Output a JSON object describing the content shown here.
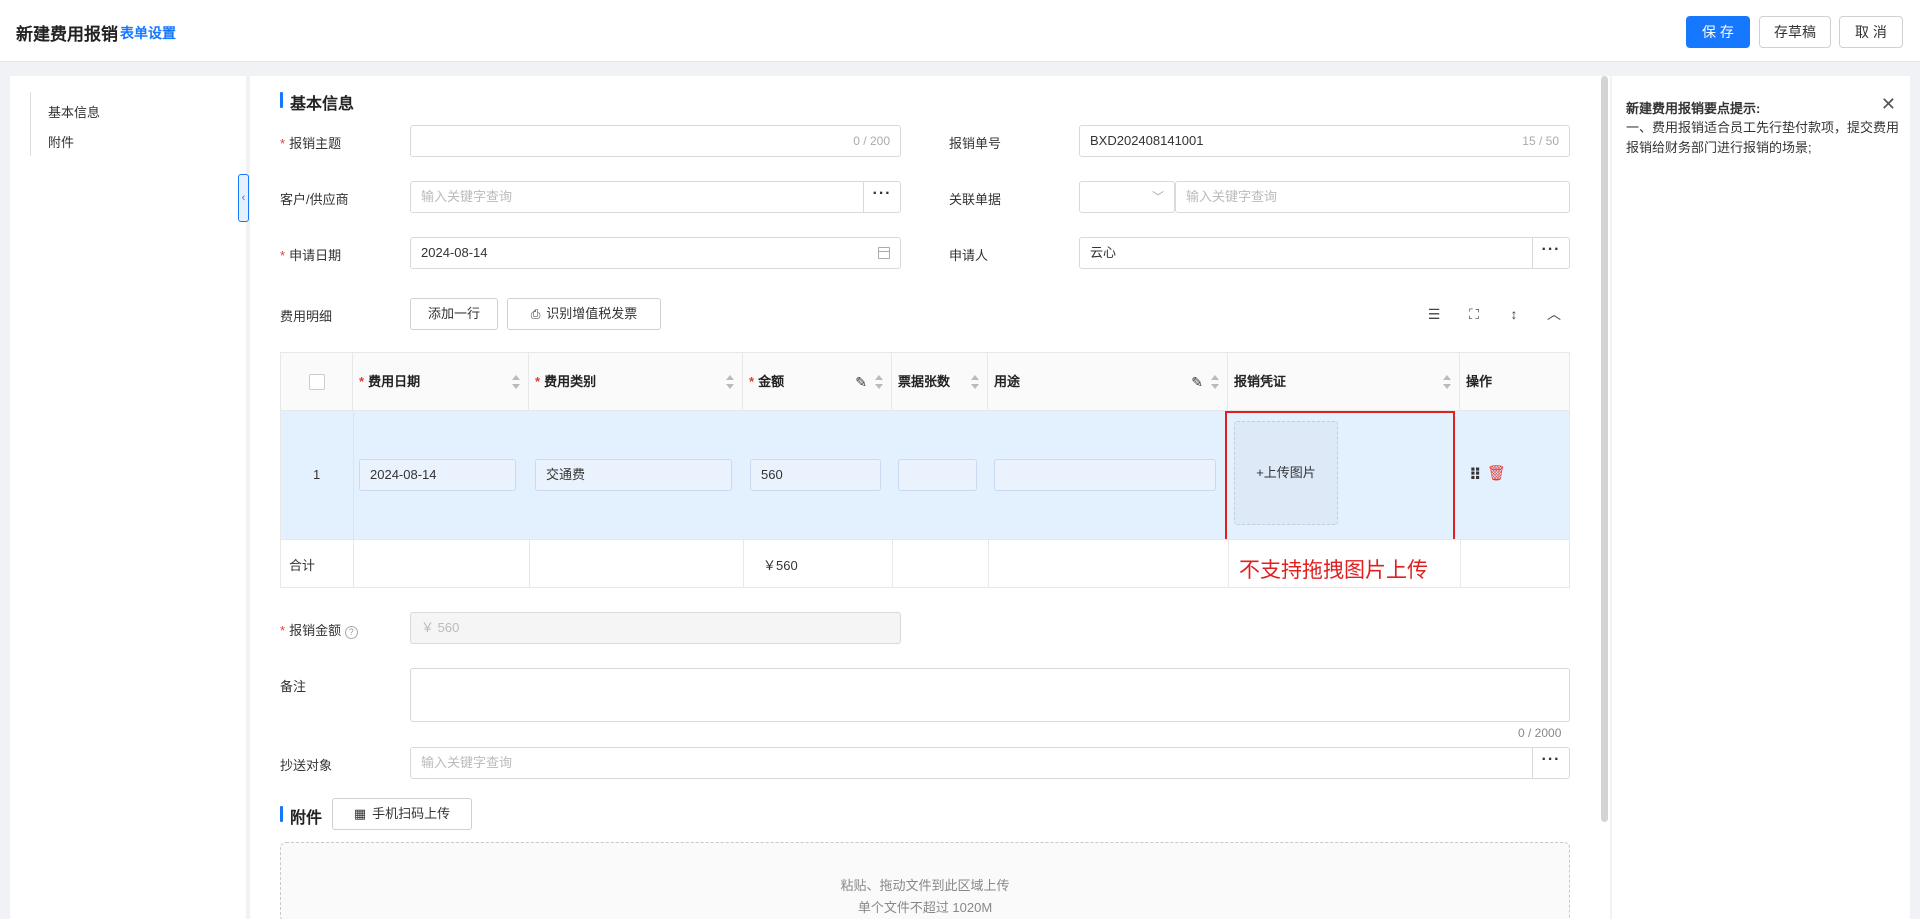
{
  "header": {
    "title": "新建费用报销",
    "form_settings": "表单设置",
    "save": "保 存",
    "draft": "存草稿",
    "cancel": "取 消"
  },
  "leftnav": {
    "items": [
      "基本信息",
      "附件"
    ]
  },
  "basic": {
    "section_title": "基本信息",
    "subject_label": "报销主题",
    "subject_count": "0 / 200",
    "number_label": "报销单号",
    "number_value": "BXD202408141001",
    "number_count": "15 / 50",
    "customer_label": "客户/供应商",
    "customer_placeholder": "输入关键字查询",
    "related_label": "关联单据",
    "related_placeholder": "输入关键字查询",
    "date_label": "申请日期",
    "date_value": "2024-08-14",
    "applicant_label": "申请人",
    "applicant_value": "云心",
    "detail_label": "费用明细",
    "add_row": "添加一行",
    "recognize_invoice": "识别增值税发票"
  },
  "table": {
    "headers": {
      "date": "费用日期",
      "category": "费用类别",
      "amount": "金额",
      "tickets": "票据张数",
      "purpose": "用途",
      "voucher": "报销凭证",
      "actions": "操作"
    },
    "rows": [
      {
        "index": "1",
        "date": "2024-08-14",
        "category": "交通费",
        "amount": "560",
        "tickets": "",
        "purpose": "",
        "upload": "+上传图片"
      }
    ],
    "total_label": "合计",
    "total_amount": "￥560",
    "annotation": "不支持拖拽图片上传"
  },
  "amount": {
    "label": "报销金额",
    "value": "￥ 560"
  },
  "remark": {
    "label": "备注",
    "count": "0 / 2000"
  },
  "cc": {
    "label": "抄送对象",
    "placeholder": "输入关键字查询"
  },
  "attachment": {
    "section_title": "附件",
    "mobile_upload": "手机扫码上传",
    "drop_text": "粘贴、拖动文件到此区域上传",
    "size_text": "单个文件不超过 1020M"
  },
  "tips": {
    "title": "新建费用报销要点提示:",
    "content": "一、费用报销适合员工先行垫付款项，提交费用报销给财务部门进行报销的场景;"
  }
}
